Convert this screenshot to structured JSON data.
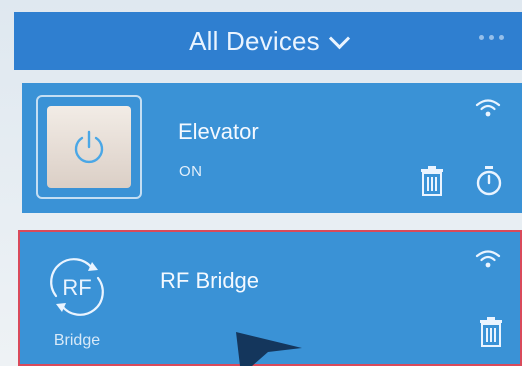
{
  "header": {
    "title": "All Devices",
    "icons": {
      "dropdown": "chevron-down-icon",
      "more": "more-dots-icon"
    }
  },
  "devices": [
    {
      "name": "Elevator",
      "status": "ON",
      "icons": [
        "power-icon",
        "wifi-icon",
        "trash-icon",
        "timer-icon"
      ]
    },
    {
      "name": "RF Bridge",
      "badge_text": "RF",
      "badge_caption": "Bridge",
      "icons": [
        "rf-bridge-icon",
        "wifi-icon",
        "trash-icon"
      ]
    }
  ],
  "colors": {
    "header_bg": "#2f7fd0",
    "card_bg": "#3a92d6",
    "power_icon": "#4aa7e6",
    "highlight_border": "#d94a5b"
  }
}
